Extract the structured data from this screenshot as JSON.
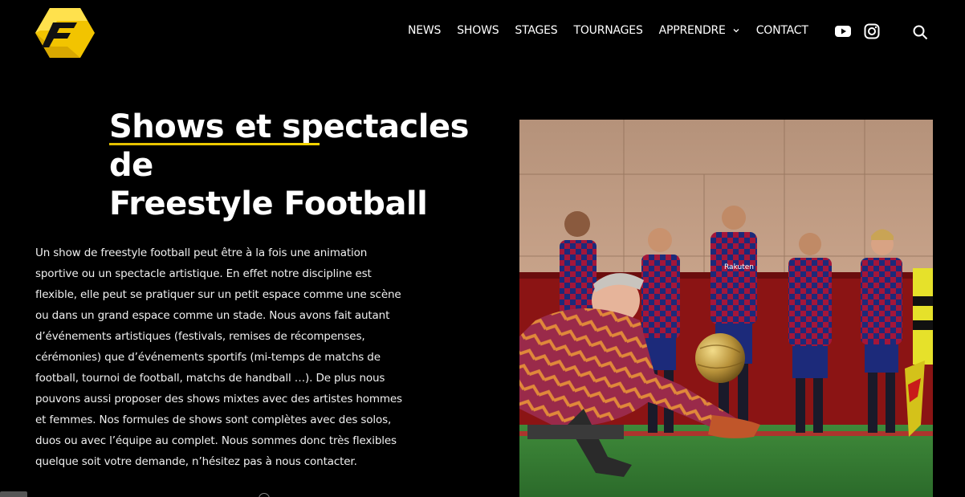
{
  "header": {
    "logo_name": "F logo",
    "nav": [
      {
        "label": "NEWS"
      },
      {
        "label": "SHOWS"
      },
      {
        "label": "STAGES"
      },
      {
        "label": "TOURNAGES"
      },
      {
        "label": "APPRENDRE",
        "has_dropdown": true
      },
      {
        "label": "CONTACT"
      }
    ],
    "social_icons": [
      "youtube-icon",
      "instagram-icon"
    ],
    "search_icon": "search-icon"
  },
  "main": {
    "title_line1": "Shows et spectacles de",
    "title_line2": "Freestyle Football",
    "paragraph": "Un show de freestyle football peut être à la fois une animation sportive ou un spectacle artistique. En effet notre discipline est flexible, elle peut se pratiquer sur un petit espace comme une scène ou dans un grand espace comme un stade. Nous avons fait autant d’événements artistiques (festivals, remises de récompenses, cérémonies) que d’événements sportifs (mi-temps de matchs de football, tournoi de football, matchs de handball …). De plus nous pouvons aussi proposer des shows mixtes avec des artistes hommes et femmes. Nos formules de shows sont complètes avec des solos, duos ou avec l’équipe au complet. Nous sommes donc très flexibles quelque soit votre demande, n’hésitez pas à nous contacter.",
    "hero_jersey_text": "Rakuten"
  },
  "colors": {
    "background": "#000000",
    "accent_yellow": "#f5d400",
    "text": "#ffffff"
  }
}
